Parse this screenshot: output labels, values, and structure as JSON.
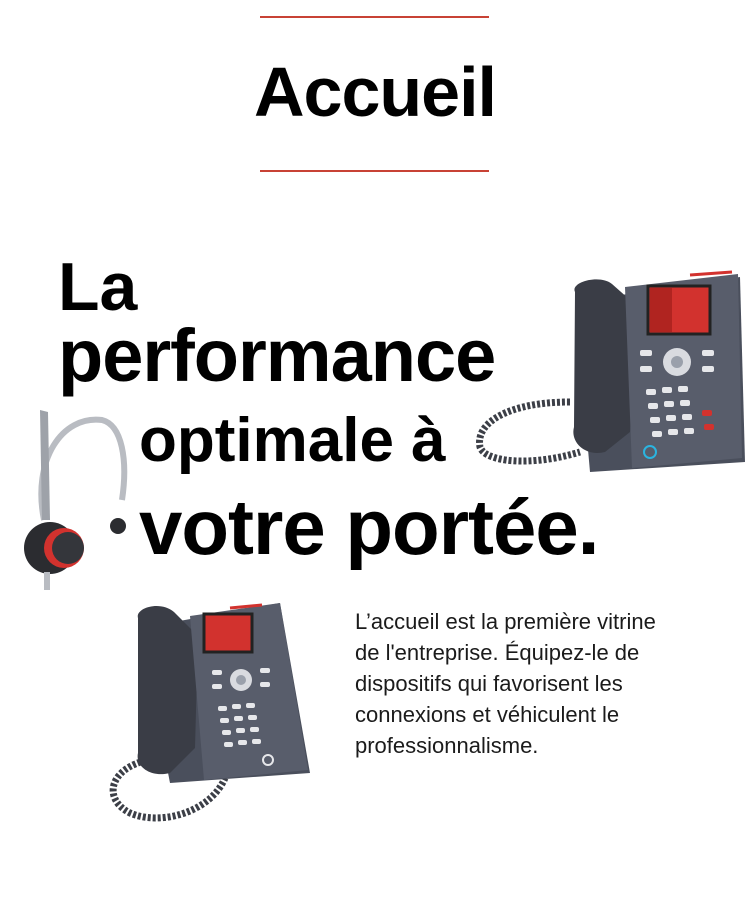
{
  "page": {
    "title": "Accueil"
  },
  "hero": {
    "line1": "La",
    "line2": "performance",
    "line3": "optimale à",
    "line4": "votre portée."
  },
  "description": "L’accueil est la première vitrine de l'entreprise. Équipez-le de dispositifs qui favorisent les connexions et véhiculent le professionnalisme.",
  "colors": {
    "accent": "#c84235",
    "device_body": "#4a4f5c",
    "screen": "#d2322e"
  },
  "images": {
    "phone_large": "desk-phone-icon",
    "phone_small": "desk-phone-icon",
    "headset": "headset-icon"
  }
}
